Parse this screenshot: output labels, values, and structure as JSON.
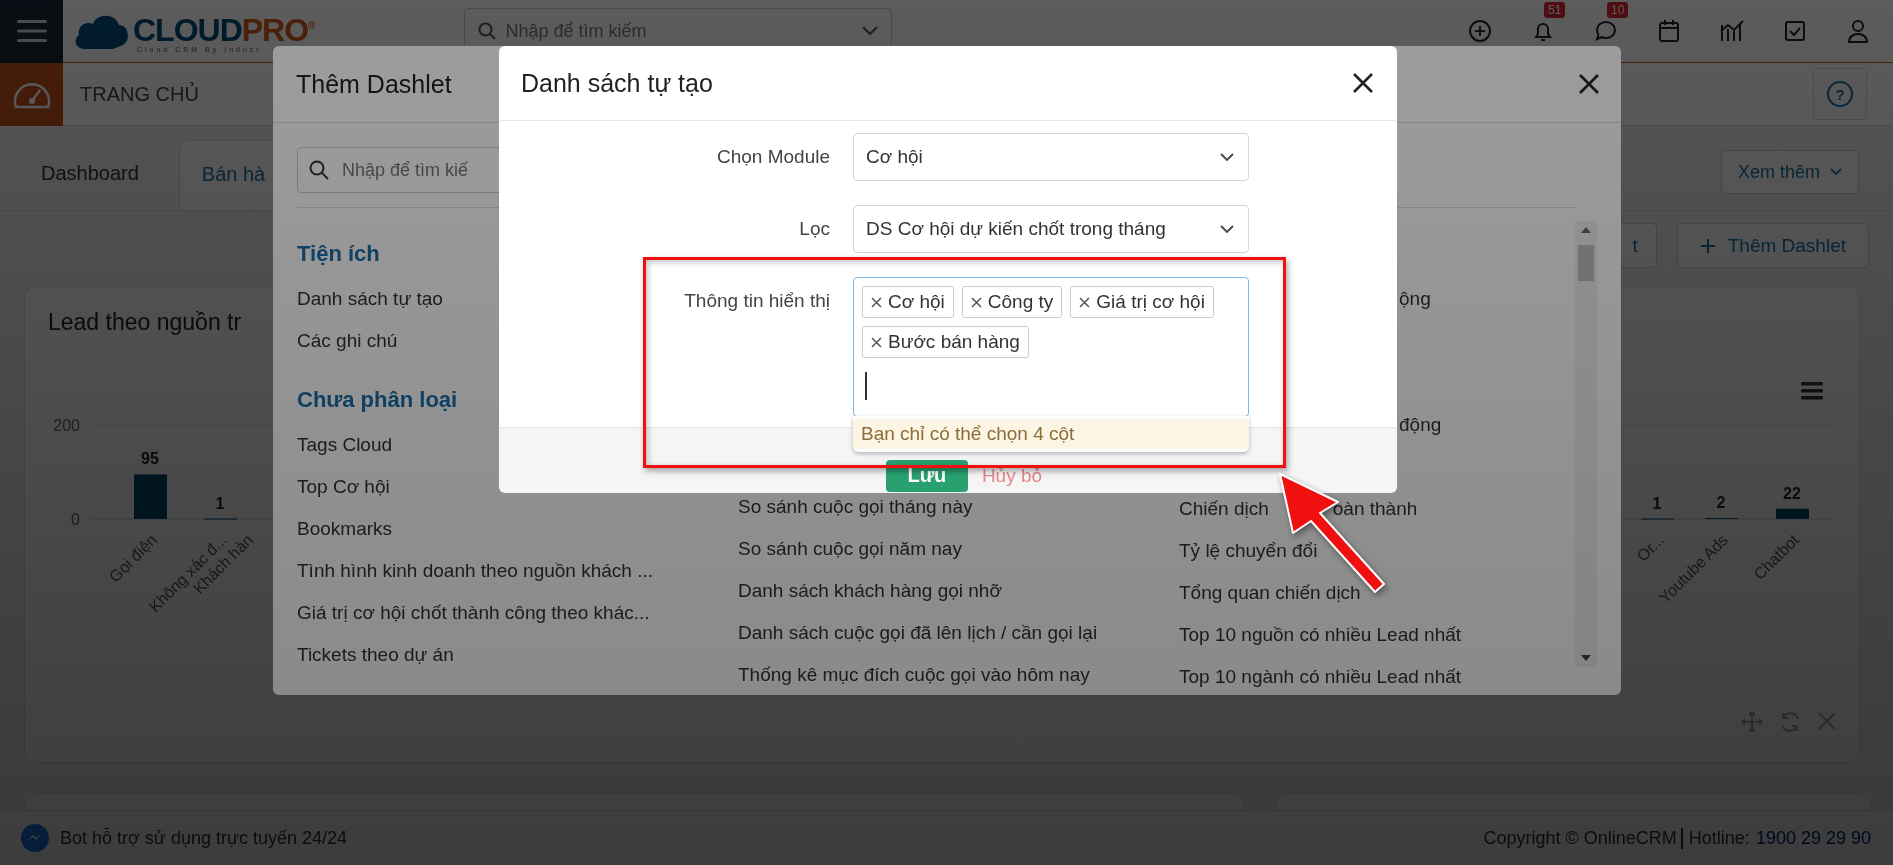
{
  "header": {
    "logo_main": "CLOUD",
    "logo_accent": "PRO",
    "logo_mark": "®",
    "logo_tagline": "Cloud CRM By Indust",
    "search_placeholder": "Nhập để tìm kiếm",
    "icons": [
      {
        "kind": "plus"
      },
      {
        "kind": "bell",
        "badge": "51"
      },
      {
        "kind": "chat",
        "badge": "10"
      },
      {
        "kind": "calendar"
      },
      {
        "kind": "chart"
      },
      {
        "kind": "check"
      },
      {
        "kind": "user"
      }
    ]
  },
  "page_title": "TRANG CHỦ",
  "help": "?",
  "tabs": [
    {
      "label": "Dashboard",
      "selected": false
    },
    {
      "label": "Bán hà",
      "selected": true
    }
  ],
  "more_button": "Xem thêm",
  "toolbar_buttons": [
    {
      "label": "t",
      "kind": "plain"
    },
    {
      "label": "Thêm Dashlet",
      "kind": "add"
    }
  ],
  "card": {
    "title": "Lead theo nguồn tr",
    "y_labels": [
      "200",
      "0"
    ],
    "bars": [
      {
        "category": "Gọi điện",
        "value_label": "95"
      },
      {
        "category": "Không xác đ...",
        "value_label": "1"
      },
      {
        "category": "Khách hàn"
      },
      {
        "category": "Or...",
        "value_label": "1"
      },
      {
        "category": "Youtube Ads",
        "value_label": "2"
      },
      {
        "category": "Chatbot",
        "value_label": "22"
      }
    ]
  },
  "dashlet_dialog": {
    "title": "Thêm Dashlet",
    "search_placeholder": "Nhập để tìm kiế",
    "columns": [
      [
        {
          "kind": "heading",
          "text": "Tiện ích"
        },
        {
          "kind": "item",
          "text": "Danh sách tự tạo"
        },
        {
          "kind": "item",
          "text": "Các ghi chú"
        },
        {
          "kind": "heading",
          "text": "Chưa phân loại"
        },
        {
          "kind": "item",
          "text": "Tags Cloud"
        },
        {
          "kind": "item",
          "text": "Top Cơ hội"
        },
        {
          "kind": "item",
          "text": "Bookmarks"
        },
        {
          "kind": "item",
          "text": "Tình hình kinh doanh theo nguồn khách ..."
        },
        {
          "kind": "item",
          "text": "Giá trị cơ hội chốt thành công theo khác..."
        },
        {
          "kind": "item",
          "text": "Tickets theo dự án"
        }
      ],
      [
        {
          "kind": "item",
          "text": "So sánh cuộc gọi tháng này"
        },
        {
          "kind": "item",
          "text": "So sánh cuộc gọi năm nay"
        },
        {
          "kind": "item",
          "text": "Danh sách khách hàng gọi nhỡ"
        },
        {
          "kind": "item",
          "text": "Danh sách cuộc gọi đã lên lịch / cần gọi lại"
        },
        {
          "kind": "item",
          "text": "Thống kê mục đích cuộc gọi vào hôm nay"
        }
      ],
      [
        {
          "kind": "fragment",
          "text": "ộng"
        },
        {
          "kind": "fragment",
          "text": "động"
        },
        {
          "kind": "item",
          "text": "Chiến dịch",
          "tail": "oàn thành"
        },
        {
          "kind": "item",
          "text": "Tỷ lệ chuyển đổi"
        },
        {
          "kind": "item",
          "text": "Tổng quan chiến dịch"
        },
        {
          "kind": "item",
          "text": "Top 10 nguồn có nhiều Lead nhất"
        },
        {
          "kind": "item",
          "text": "Top 10 ngành có nhiều Lead nhất"
        }
      ]
    ]
  },
  "custom_list_dialog": {
    "title": "Danh sách tự tạo",
    "fields": [
      {
        "label": "Chọn Module",
        "kind": "select",
        "value": "Cơ hội"
      },
      {
        "label": "Lọc",
        "kind": "select",
        "value": "DS Cơ hội dự kiến chốt trong tháng"
      },
      {
        "label": "Thông tin hiển thị",
        "kind": "tags",
        "tags": [
          "Cơ hội",
          "Công ty",
          "Giá trị cơ hội",
          "Bước bán hàng"
        ]
      }
    ],
    "limit_message": "Bạn chỉ có thể chọn 4 cột",
    "save_button": "Lưu",
    "cancel_button": "Hủy bỏ"
  },
  "footer": {
    "bot_text": "Bot hỗ trợ sử dụng trực tuyến 24/24",
    "copyright": "Copyright © OnlineCRM",
    "hotline_label": "Hotline:",
    "hotline": "1900 29 29 90"
  }
}
